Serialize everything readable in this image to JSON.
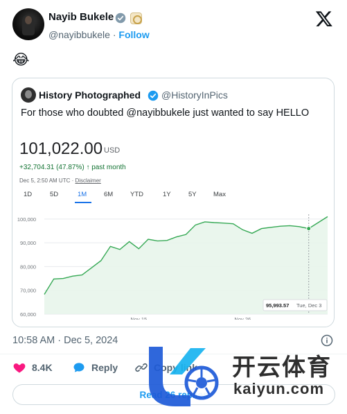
{
  "post": {
    "author_name": "Nayib Bukele",
    "handle": "@nayibbukele",
    "separator": "·",
    "follow_label": "Follow",
    "body_emoji": "😂",
    "timestamp": "10:58 AM · Dec 5, 2024"
  },
  "quoted": {
    "author_name": "History Photographed",
    "handle": "@HistoryInPics",
    "text": "For those who doubted @nayibbukele just wanted to say HELLO"
  },
  "stock": {
    "price": "101,022.00",
    "currency": "USD",
    "change": "+32,704.31 (47.87%)",
    "change_arrow": "↑",
    "change_period": "past month",
    "as_of": "Dec 5, 2:50 AM UTC · ",
    "disclaimer": "Disclaimer",
    "ranges": [
      "1D",
      "5D",
      "1M",
      "6M",
      "YTD",
      "1Y",
      "5Y",
      "Max"
    ],
    "active_range": "1M",
    "accent_color": "#137333"
  },
  "chart_data": {
    "type": "area",
    "x": [
      "Nov 5",
      "Nov 6",
      "Nov 7",
      "Nov 8",
      "Nov 9",
      "Nov 10",
      "Nov 11",
      "Nov 12",
      "Nov 13",
      "Nov 14",
      "Nov 15",
      "Nov 16",
      "Nov 17",
      "Nov 18",
      "Nov 19",
      "Nov 20",
      "Nov 21",
      "Nov 22",
      "Nov 23",
      "Nov 24",
      "Nov 25",
      "Nov 26",
      "Nov 27",
      "Nov 28",
      "Nov 29",
      "Nov 30",
      "Dec 1",
      "Dec 2",
      "Dec 3",
      "Dec 4",
      "Dec 5"
    ],
    "values": [
      68300,
      74800,
      75000,
      76000,
      76500,
      79500,
      82500,
      88500,
      87200,
      90500,
      87500,
      91500,
      90800,
      91000,
      92500,
      93500,
      97500,
      98800,
      98500,
      98300,
      98000,
      95500,
      94000,
      96000,
      96500,
      97000,
      97200,
      96800,
      95994,
      98500,
      101022
    ],
    "x_ticks": [
      "Nov 15",
      "Nov 26"
    ],
    "y_ticks": [
      "60,000",
      "70,000",
      "80,000",
      "90,000",
      "100,000"
    ],
    "ylim": [
      60000,
      102000
    ],
    "grid": true,
    "tooltip": {
      "value": "95,993.57",
      "date": "Tue, Dec 3"
    },
    "line_color": "#34a853",
    "fill_color": "#e6f4ea"
  },
  "actions": {
    "likes": "8.4K",
    "reply_label": "Reply",
    "copy_link_label": "Copy link",
    "read_replies_label": "Read 26 replies"
  },
  "watermark": {
    "cn": "开云体育",
    "en": "kaiyun.com"
  }
}
